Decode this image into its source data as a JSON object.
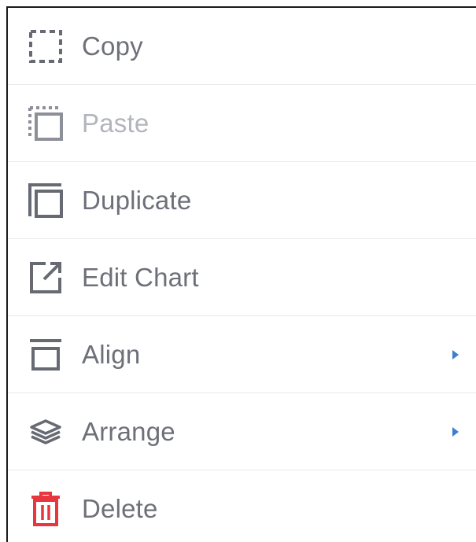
{
  "menu": {
    "items": [
      {
        "label": "Copy",
        "icon": "copy-icon",
        "enabled": true,
        "has_submenu": false
      },
      {
        "label": "Paste",
        "icon": "paste-icon",
        "enabled": false,
        "has_submenu": false
      },
      {
        "label": "Duplicate",
        "icon": "duplicate-icon",
        "enabled": true,
        "has_submenu": false
      },
      {
        "label": "Edit Chart",
        "icon": "external-link-icon",
        "enabled": true,
        "has_submenu": false
      },
      {
        "label": "Align",
        "icon": "align-top-icon",
        "enabled": true,
        "has_submenu": true
      },
      {
        "label": "Arrange",
        "icon": "layers-icon",
        "enabled": true,
        "has_submenu": true
      },
      {
        "label": "Delete",
        "icon": "trash-icon",
        "enabled": true,
        "has_submenu": false
      }
    ]
  },
  "colors": {
    "text": "#6e7079",
    "disabled_text": "#b3b5bc",
    "icon": "#676a73",
    "delete_icon": "#e8363f",
    "submenu_arrow": "#3e7ed0",
    "divider": "#e9e9eb"
  }
}
